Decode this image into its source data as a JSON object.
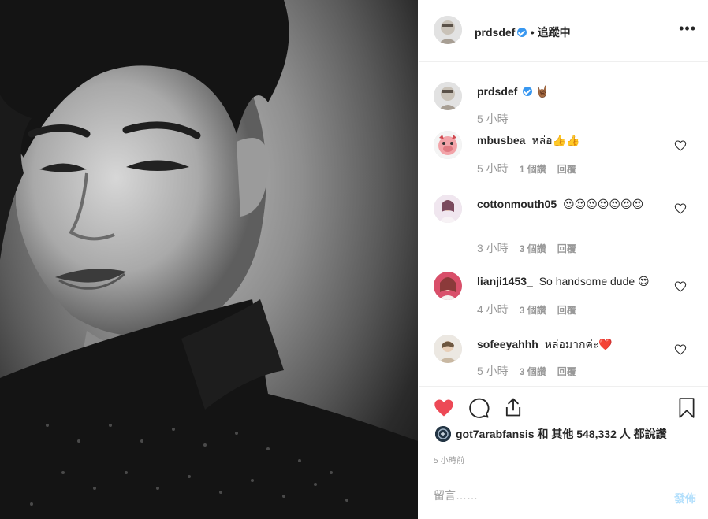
{
  "post": {
    "photo_alt": "",
    "owner": {
      "username": "prdsdef",
      "verified": true,
      "follow_label": "• 追蹤中"
    }
  },
  "caption": {
    "username": "prdsdef",
    "text": "🤘🏾",
    "time": "5 小時"
  },
  "comments": [
    {
      "username": "mbusbea",
      "text": "หล่อ👍👍",
      "time": "5 小時",
      "likes": "1 個讚",
      "reply": "回覆"
    },
    {
      "username": "cottonmouth05",
      "text": "😍😍😍😍😍😍😍",
      "time": "3 小時",
      "likes": "3 個讚",
      "reply": "回覆"
    },
    {
      "username": "lianji1453_",
      "text": "So handsome dude 😍",
      "time": "4 小時",
      "likes": "3 個讚",
      "reply": "回覆"
    },
    {
      "username": "sofeeyahhh",
      "text": "หล่อมากค่ะ❤️",
      "time": "5 小時",
      "likes": "3 個讚",
      "reply": "回覆"
    }
  ],
  "likes_summary": {
    "username": "got7arabfansis",
    "text": "和 其他 548,332 人 都說讚"
  },
  "time_ago": "5 小時前",
  "comment_box": {
    "placeholder": "留言……",
    "post_label": "發佈"
  },
  "colors": {
    "verified": "#3897f0",
    "liked_heart": "#ed4956",
    "post_disabled": "#b2dffc"
  },
  "icons": [
    "more-icon",
    "heart-filled-icon",
    "comment-icon",
    "share-icon",
    "bookmark-icon",
    "heart-outline-icon"
  ]
}
